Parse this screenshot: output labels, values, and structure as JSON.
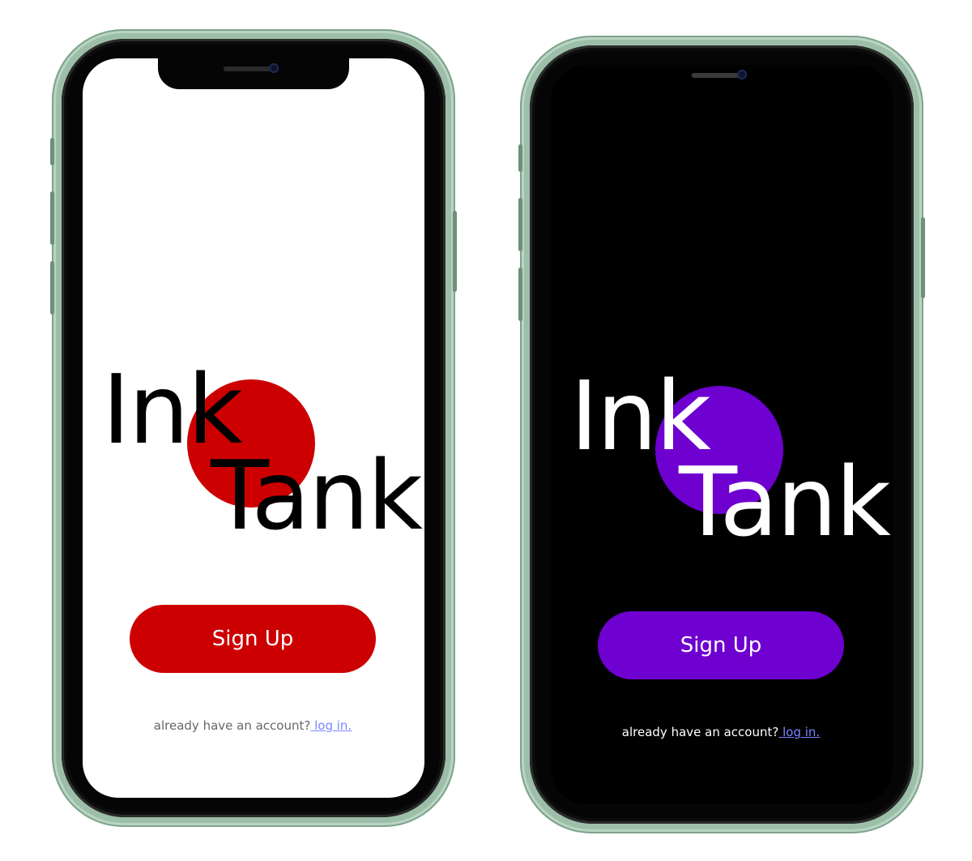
{
  "colors": {
    "frame": "#9dbfa9",
    "light_accent": "#cc0000",
    "dark_accent": "#6e00d0",
    "link": "#7a86ff"
  },
  "phones": [
    {
      "theme": "light",
      "logo": {
        "line1": "Ink",
        "line2": "Tank"
      },
      "signup_label": "Sign Up",
      "login_prompt": "already have an account?",
      "login_link": " log in."
    },
    {
      "theme": "dark",
      "logo": {
        "line1": "Ink",
        "line2": "Tank"
      },
      "signup_label": "Sign Up",
      "login_prompt": "already have an account?",
      "login_link": " log in."
    }
  ]
}
